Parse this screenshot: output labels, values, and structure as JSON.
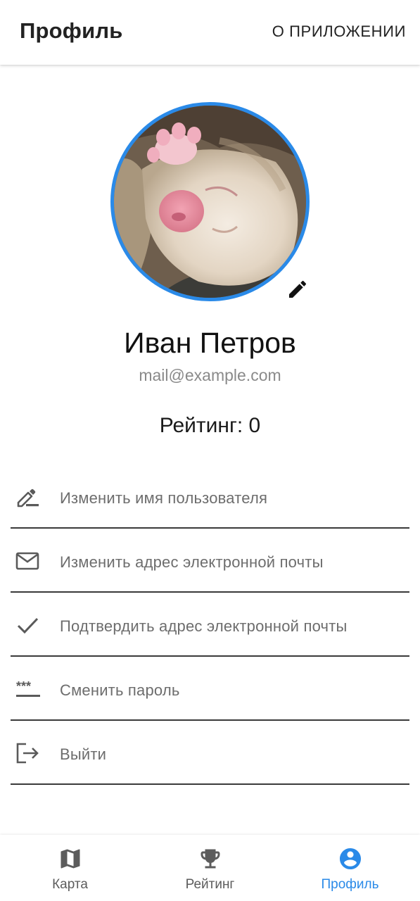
{
  "appbar": {
    "title": "Профиль",
    "action_label": "О ПРИЛОЖЕНИИ"
  },
  "profile": {
    "name": "Иван Петров",
    "email": "mail@example.com",
    "rating_text": "Рейтинг: 0",
    "avatar_border_color": "#2a8ae8"
  },
  "menu": {
    "items": [
      {
        "icon": "edit-name-icon",
        "label": "Изменить имя пользователя"
      },
      {
        "icon": "mail-icon",
        "label": "Изменить адрес электронной почты"
      },
      {
        "icon": "check-icon",
        "label": "Подтвердить адрес электронной почты"
      },
      {
        "icon": "password-icon",
        "label": "Сменить пароль"
      },
      {
        "icon": "logout-icon",
        "label": "Выйти"
      }
    ]
  },
  "bottom_nav": {
    "items": [
      {
        "icon": "map-icon",
        "label": "Карта",
        "active": false
      },
      {
        "icon": "trophy-icon",
        "label": "Рейтинг",
        "active": false
      },
      {
        "icon": "account-circle-icon",
        "label": "Профиль",
        "active": true
      }
    ],
    "active_color": "#2a8ae8",
    "inactive_color": "#5c5c5c"
  }
}
